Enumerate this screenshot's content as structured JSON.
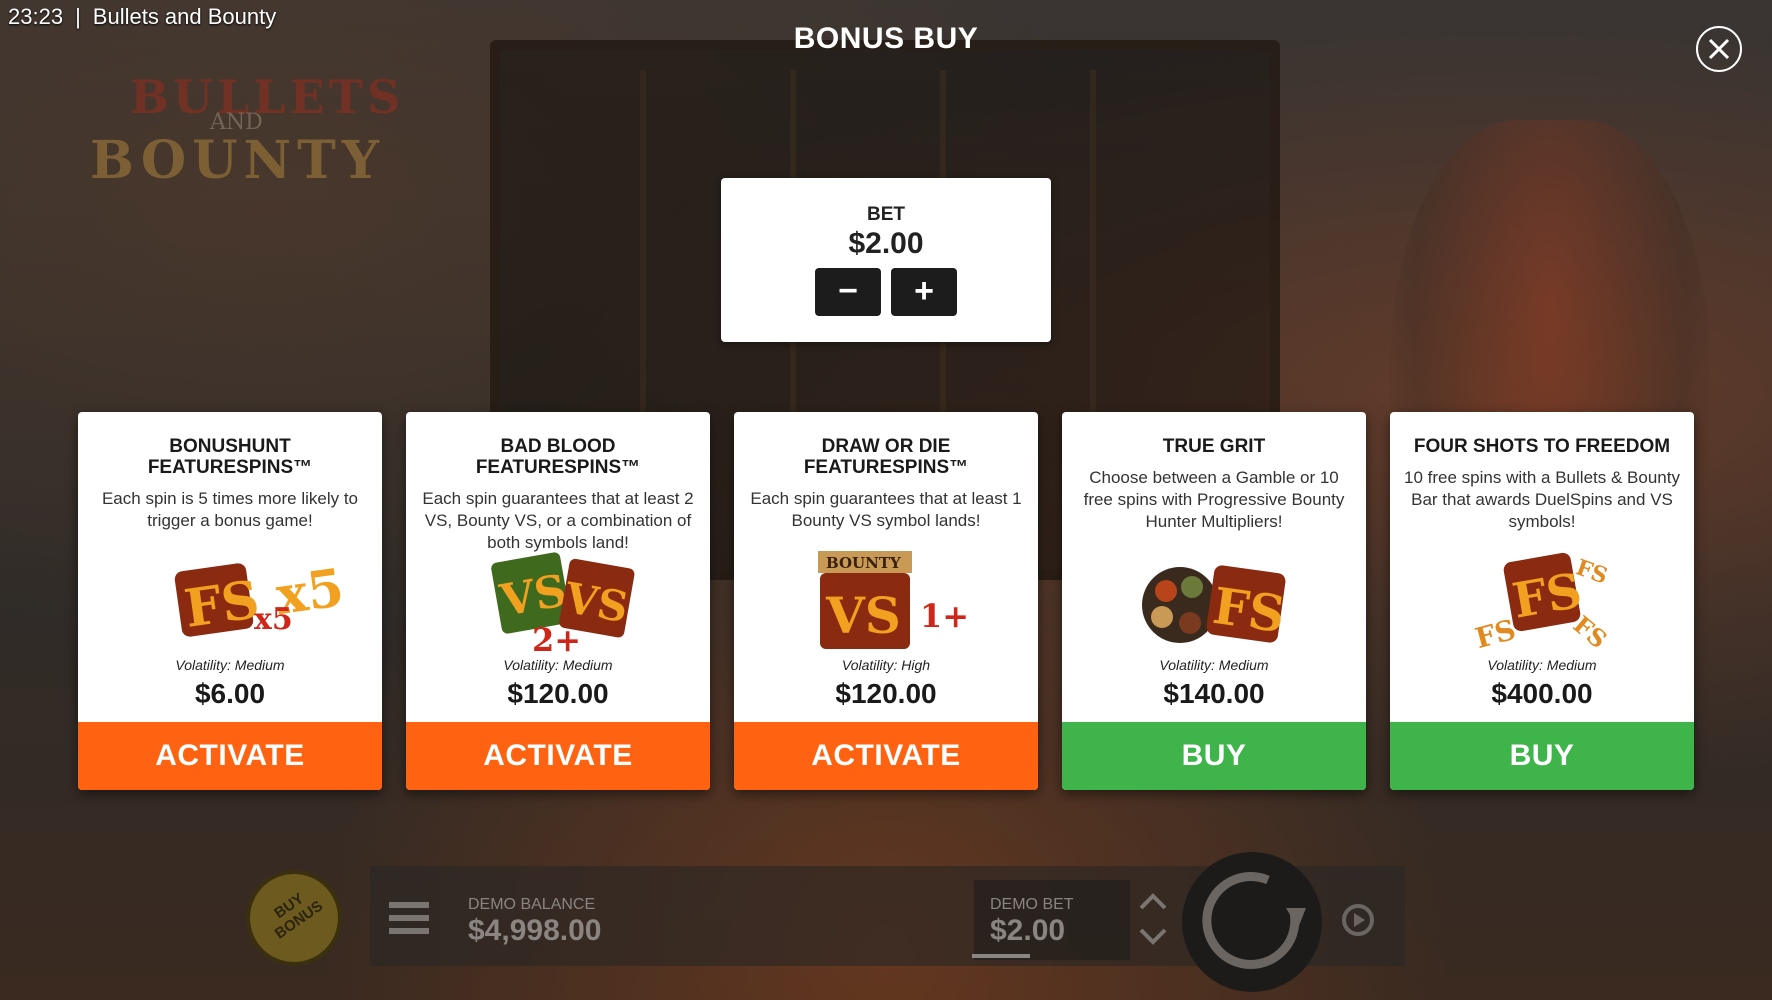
{
  "status_bar": {
    "time": "23:23",
    "game_name": "Bullets and Bounty"
  },
  "background": {
    "logo_line1": "BULLETS",
    "logo_line2": "AND",
    "logo_line3": "BOUNTY"
  },
  "title": "BONUS BUY",
  "close_icon": "close-icon",
  "bet_panel": {
    "label": "BET",
    "value": "$2.00",
    "decrease": "−",
    "increase": "+"
  },
  "cards": [
    {
      "name": "BONUSHUNT FEATURESPINS™",
      "description": "Each spin is 5 times more likely to trigger a bonus game!",
      "art": "FS x5",
      "volatility": "Volatility: Medium",
      "price": "$6.00",
      "button": "ACTIVATE",
      "button_color": "#ff6210"
    },
    {
      "name": "BAD BLOOD FEATURESPINS™",
      "description": "Each spin guarantees that at least 2 VS, Bounty VS, or a combination of both symbols land!",
      "art": "VS VS 2+",
      "volatility": "Volatility: Medium",
      "price": "$120.00",
      "button": "ACTIVATE",
      "button_color": "#ff6210"
    },
    {
      "name": "DRAW OR DIE FEATURESPINS™",
      "description": "Each spin guarantees that at least 1 Bounty VS symbol lands!",
      "art": "BOUNTY VS 1+",
      "volatility": "Volatility: High",
      "price": "$120.00",
      "button": "ACTIVATE",
      "button_color": "#ff6210"
    },
    {
      "name": "TRUE GRIT",
      "description": "Choose between a Gamble or 10 free spins with Progressive Bounty Hunter Multipliers!",
      "art": "FS",
      "volatility": "Volatility: Medium",
      "price": "$140.00",
      "button": "BUY",
      "button_color": "#3fb44a"
    },
    {
      "name": "FOUR SHOTS TO FREEDOM",
      "description": "10 free spins with a Bullets & Bounty Bar that awards DuelSpins and VS symbols!",
      "art": "FS FS FS",
      "volatility": "Volatility: Medium",
      "price": "$400.00",
      "button": "BUY",
      "button_color": "#3fb44a"
    }
  ],
  "bottom_bar": {
    "buy_bonus_label": "BUY BONUS",
    "demo_balance_label": "DEMO BALANCE",
    "demo_balance_value": "$4,998.00",
    "demo_bet_label": "DEMO BET",
    "demo_bet_value": "$2.00"
  },
  "colors": {
    "activate": "#ff6210",
    "buy": "#3fb44a",
    "panel": "#ffffff"
  }
}
